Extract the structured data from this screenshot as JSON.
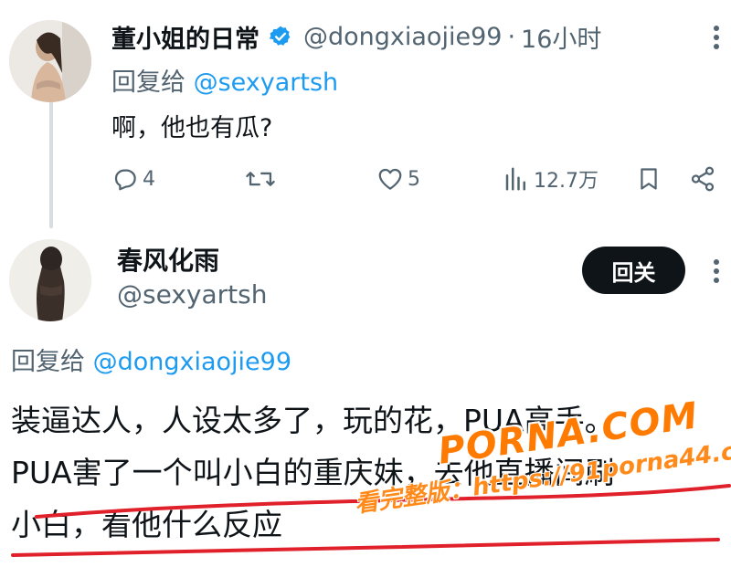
{
  "tweet1": {
    "display_name": "董小姐的日常",
    "handle": "@dongxiaojie99",
    "separator": "·",
    "time": "16小时",
    "reply_prefix": "回复给",
    "reply_mention": "@sexyartsh",
    "text": "啊，他也有瓜?",
    "actions": {
      "replies": "4",
      "likes": "5",
      "views": "12.7万"
    },
    "icons": {
      "verified": "verified-badge-icon",
      "more": "more-vertical-icon",
      "reply": "reply-icon",
      "retweet": "retweet-icon",
      "like": "heart-icon",
      "views": "views-chart-icon",
      "bookmark": "bookmark-icon",
      "share": "share-icon"
    },
    "verified_color": "#1d9bf0"
  },
  "tweet2": {
    "display_name": "春风化雨",
    "handle": "@sexyartsh",
    "follow_label": "回关",
    "reply_prefix": "回复给",
    "reply_mention": "@dongxiaojie99",
    "lines": [
      "装逼达人，人设太多了，玩的花，PUA高手。",
      "PUA害了一个叫小白的重庆妹，去他直播间刷",
      "小白，看他什么反应"
    ],
    "underline_color": "#e0202a"
  },
  "watermark": {
    "logo": "PORNA.COM",
    "url": "看完整版：https://91porna44.com",
    "color": "#ff7a00"
  },
  "colors": {
    "text": "#0f1419",
    "secondary": "#536471",
    "link": "#1d9bf0",
    "button_bg": "#0f1419"
  }
}
